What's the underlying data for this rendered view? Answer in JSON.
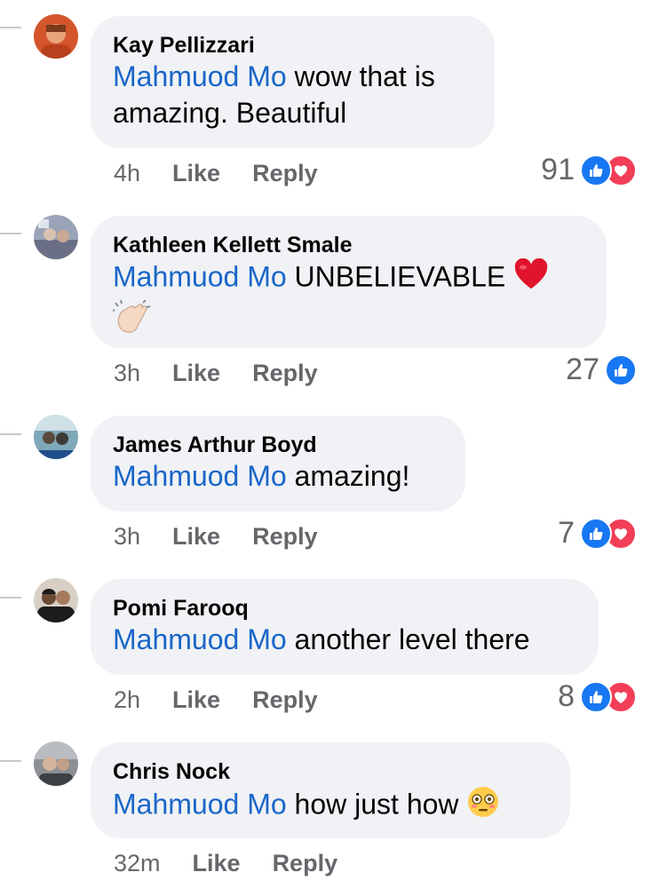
{
  "colors": {
    "mention": "#1a66c9",
    "like": "#1877f2",
    "love": "#f33e58",
    "meta": "#65676b",
    "bubble": "#f0f2f5"
  },
  "comments": [
    {
      "author": "Kay Pellizzari",
      "mention": "Mahmuod Mo",
      "text_line1": " wow that is",
      "text_line2": "amazing. Beautiful",
      "time": "4h",
      "like_label": "Like",
      "reply_label": "Reply",
      "reaction_count": "91",
      "reactions": [
        "like-icon",
        "love-icon"
      ]
    },
    {
      "author": "Kathleen Kellett Smale",
      "mention": "Mahmuod Mo",
      "text_line1": " UNBELIEVABLE ",
      "emoji1": "red-heart",
      "emoji2": "clapping-hands",
      "time": "3h",
      "like_label": "Like",
      "reply_label": "Reply",
      "reaction_count": "27",
      "reactions": [
        "like-icon"
      ]
    },
    {
      "author": "James Arthur Boyd",
      "mention": "Mahmuod Mo",
      "text_line1": " amazing!",
      "time": "3h",
      "like_label": "Like",
      "reply_label": "Reply",
      "reaction_count": "7",
      "reactions": [
        "like-icon",
        "love-icon"
      ]
    },
    {
      "author": "Pomi Farooq",
      "mention": "Mahmuod Mo",
      "text_line1": " another level there",
      "time": "2h",
      "like_label": "Like",
      "reply_label": "Reply",
      "reaction_count": "8",
      "reactions": [
        "like-icon",
        "love-icon"
      ]
    },
    {
      "author": "Chris Nock",
      "mention": "Mahmuod Mo",
      "text_line1": " how just how ",
      "emoji1": "flushed-face",
      "time": "32m",
      "like_label": "Like",
      "reply_label": "Reply"
    }
  ]
}
